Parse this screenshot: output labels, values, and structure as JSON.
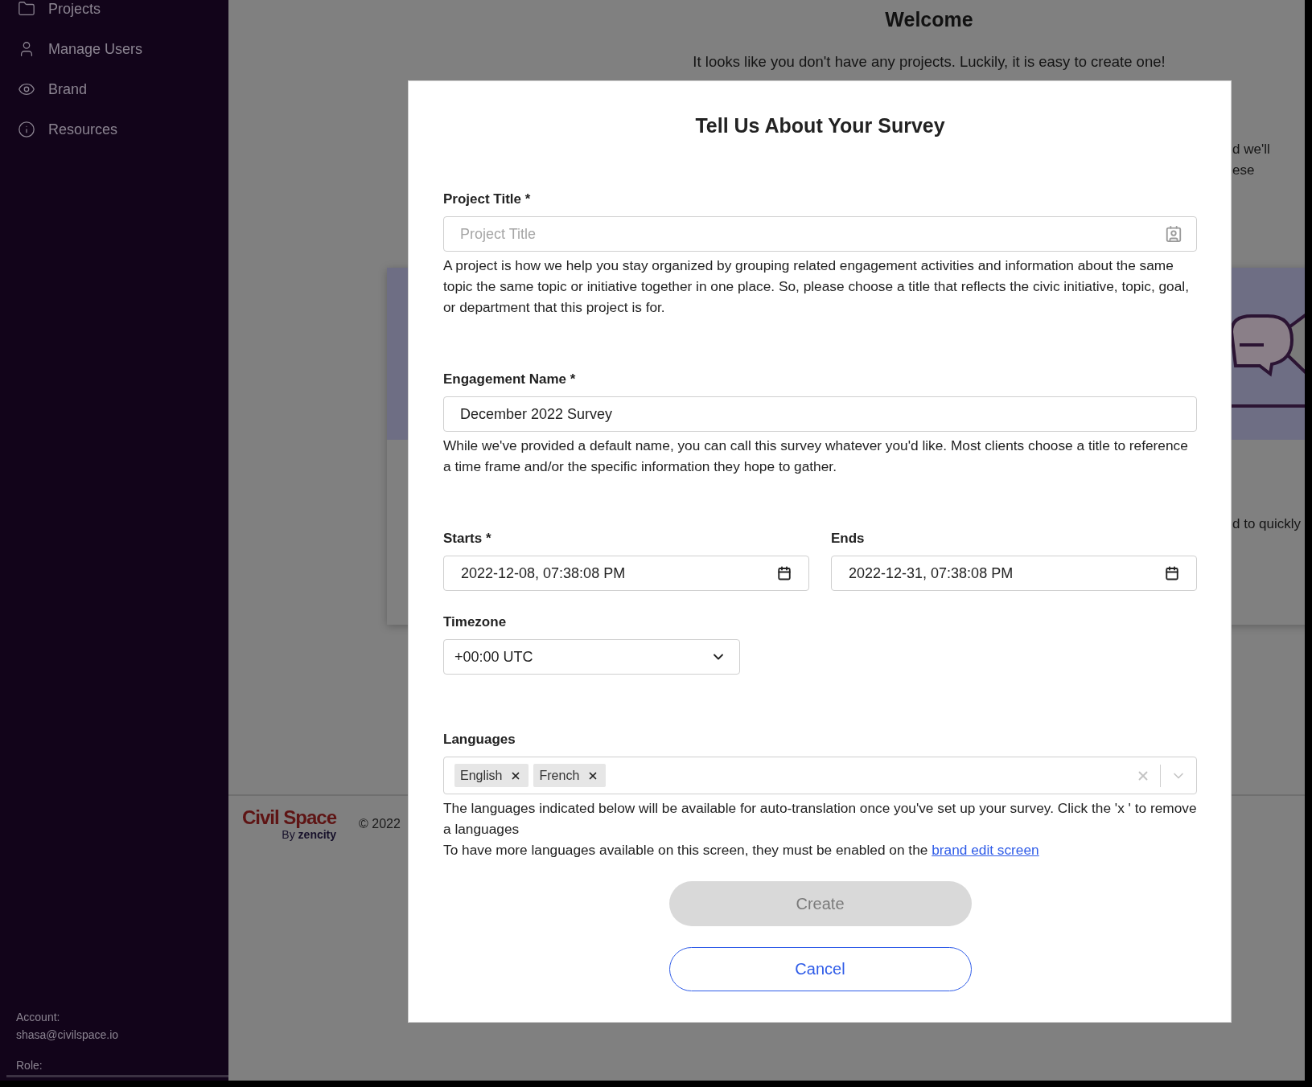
{
  "sidebar": {
    "items": [
      {
        "label": "Projects"
      },
      {
        "label": "Manage Users"
      },
      {
        "label": "Brand"
      },
      {
        "label": "Resources"
      }
    ],
    "account_label": "Account:",
    "account_email": "shasa@civilspace.io",
    "role_label": "Role:"
  },
  "background": {
    "title": "Welcome",
    "intro": "It looks like you don't have any projects. Luckily, it is easy to create one!",
    "intro_fragments": [
      "d we'll",
      "ese"
    ],
    "card_fragment": "d to quickly",
    "footer": {
      "logo": "Civil Space",
      "logo_by": "By",
      "logo_brand": "zencity",
      "copyright": "© 2022"
    }
  },
  "dialog": {
    "title": "Tell Us About Your Survey",
    "project_title": {
      "label": "Project Title *",
      "placeholder": "Project Title",
      "help": "A project is how we help you stay organized by grouping related engagement activities and information about the same topic the same topic or initiative together in one place. So, please choose a title that reflects the civic initiative, topic, goal, or department that this project is for."
    },
    "engagement_name": {
      "label": "Engagement Name *",
      "value": "December 2022 Survey",
      "help": "While we've provided a default name, you can call this survey whatever you'd like. Most clients choose a title to reference a time frame and/or the specific information they hope to gather."
    },
    "starts": {
      "label": "Starts *",
      "value": "2022-12-08, 07:38:08 PM"
    },
    "ends": {
      "label": "Ends",
      "value": "2022-12-31, 07:38:08 PM"
    },
    "timezone": {
      "label": "Timezone",
      "value": "+00:00 UTC"
    },
    "languages": {
      "label": "Languages",
      "tags": [
        "English",
        "French"
      ],
      "help": "The languages indicated below will be available for auto-translation once you've set up your survey. Click the 'x ' to remove a languages",
      "help2": "To have more languages available on this screen, they must be enabled on the",
      "link": "brand edit screen"
    },
    "buttons": [
      {
        "label": "Create",
        "kind": "primary",
        "disabled": true
      },
      {
        "label": "Cancel",
        "kind": "secondary",
        "disabled": false
      }
    ]
  }
}
